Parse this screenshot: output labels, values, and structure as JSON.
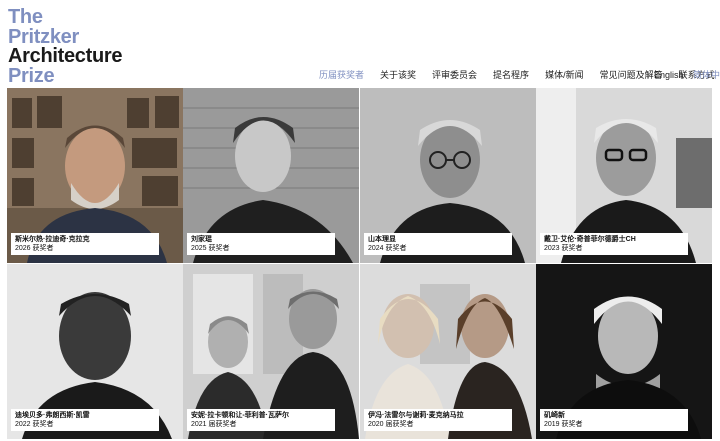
{
  "logo": {
    "line1": "The",
    "line2": "Pritzker",
    "line3": "Architecture",
    "line4": "Prize"
  },
  "nav": {
    "items": [
      {
        "label": "历届获奖者",
        "active": true
      },
      {
        "label": "关于该奖",
        "active": false
      },
      {
        "label": "评审委员会",
        "active": false
      },
      {
        "label": "提名程序",
        "active": false
      },
      {
        "label": "媒体/新闻",
        "active": false
      },
      {
        "label": "常见问题及解答",
        "active": false
      },
      {
        "label": "联系方式",
        "active": false
      }
    ],
    "lang_en": "English",
    "lang_zh": "简体中文"
  },
  "laureates": [
    {
      "name": "斯米尔热·拉迪奇·克拉克",
      "year": "2026 获奖者"
    },
    {
      "name": "刘家琨",
      "year": "2025 获奖者"
    },
    {
      "name": "山本理显",
      "year": "2024 获奖者"
    },
    {
      "name": "戴卫·艾伦·奇普菲尔德爵士CH",
      "year": "2023 获奖者"
    },
    {
      "name": "迪埃贝多·弗朗西斯·凯雷",
      "year": "2022 获奖者"
    },
    {
      "name": "安妮·拉卡顿和让-菲利普·瓦萨尔",
      "year": "2021 届获奖者"
    },
    {
      "name": "伊冯·法雷尔与谢莉·麦克纳马拉",
      "year": "2020 届获奖者"
    },
    {
      "name": "矶崎新",
      "year": "2019 获奖者"
    }
  ],
  "colors": {
    "accent": "#7f8fc0",
    "text": "#1a1a1a"
  }
}
